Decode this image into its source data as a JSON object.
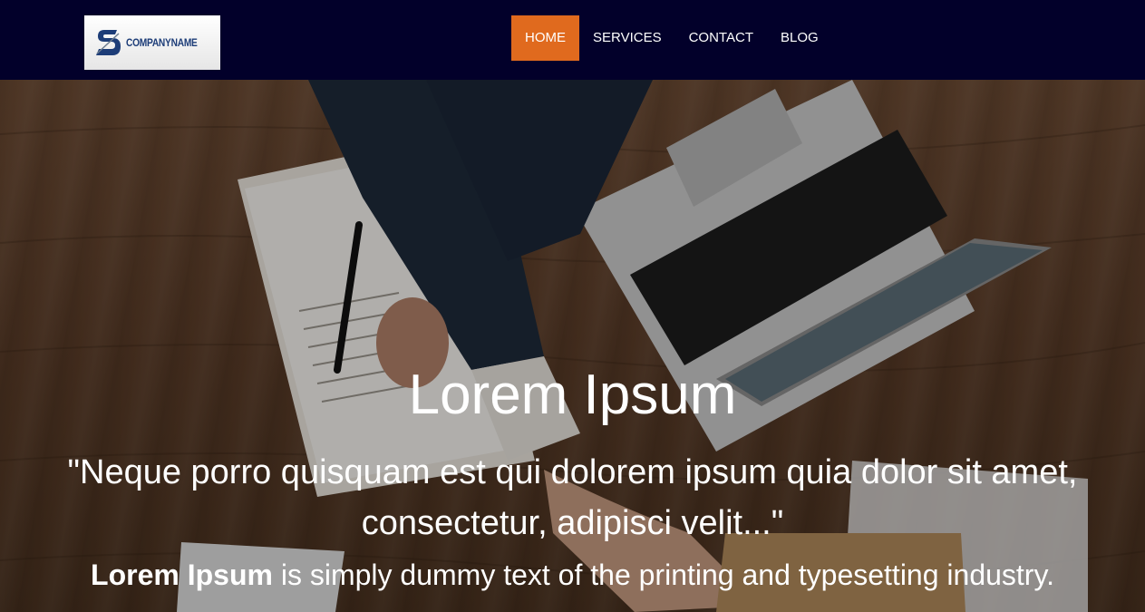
{
  "header": {
    "logo_text": "COMPANYNAME",
    "nav": [
      {
        "label": "HOME",
        "active": true
      },
      {
        "label": "SERVICES",
        "active": false
      },
      {
        "label": "CONTACT",
        "active": false
      },
      {
        "label": "BLOG",
        "active": false
      }
    ]
  },
  "hero": {
    "title": "Lorem Ipsum",
    "quote": "\"Neque porro quisquam est qui dolorem ipsum quia dolor sit amet, consectetur, adipisci velit...\"",
    "desc_bold": "Lorem Ipsum",
    "desc_rest": " is simply dummy text of the printing and typesetting industry."
  },
  "colors": {
    "navbar_bg": "#02002a",
    "nav_active_bg": "#e06a1e",
    "text": "#ffffff",
    "logo_blue": "#1d3d78"
  }
}
